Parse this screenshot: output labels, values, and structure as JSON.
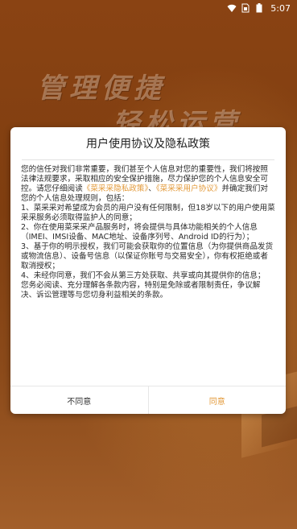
{
  "status_bar": {
    "time": "5:07"
  },
  "background": {
    "slogan_line1": "管理便捷",
    "slogan_line2": "轻松运营"
  },
  "dialog": {
    "title": "用户使用协议及隐私政策",
    "intro_1": "您的信任对我们非常重要，我们甚至个人信息对您的重要性，我们将按照法律法规要求，采取相应的安全保护措施，尽力保护您的个人信息安全可控。请您仔细阅读",
    "privacy_link": "《菜采采隐私政策》",
    "sep": "、",
    "user_agreement_link": "《菜采采用户协议》",
    "intro_2": "并确定我们对您的个人信息处理规则，包括：",
    "item_1": "1、菜采采对希望成为会员的用户没有任何限制，但18岁以下的用户使用菜采采服务必须取得监护人的同意；",
    "item_2": "2、你在使用菜采采产品服务时，将会提供与具体功能相关的个人信息（IMEI、IMSI设备、MAC地址、设备序列号、Android ID的行为）；",
    "item_3": "3、基于你的明示授权，我们可能会获取你的位置信息（为你提供商品发货或物流信息）、设备号信息（以保证你账号与交易安全），你有权拒绝或者取消授权；",
    "item_4": "4、未经你同意，我们不会从第三方处获取、共享或向其提供你的信息；",
    "closing": "您务必阅读、充分理解各条款内容，特别是免除或者限制责任，争议解决、诉讼管理等与您切身利益相关的条款。",
    "decline_label": "不同意",
    "agree_label": "同意"
  },
  "colors": {
    "accent": "#e39a3a",
    "background": "#7a3b10"
  },
  "icons": [
    "wifi-icon",
    "sim-icon",
    "battery-icon"
  ]
}
